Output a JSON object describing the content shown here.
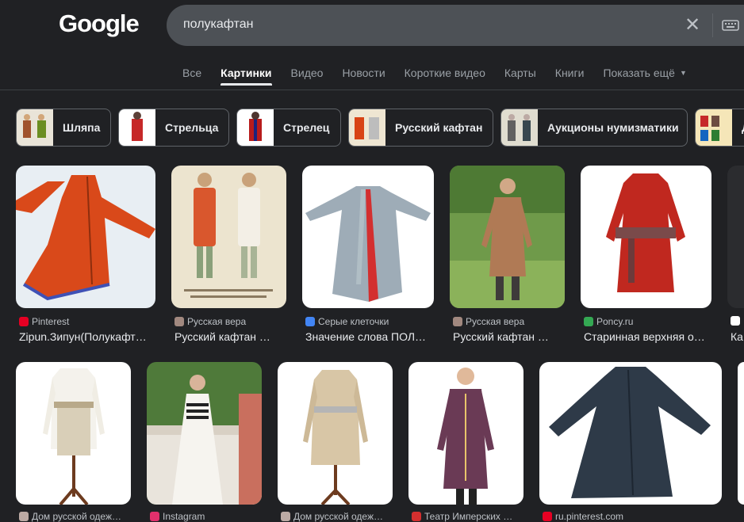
{
  "header": {
    "logo": "Google",
    "query": "полукафтан"
  },
  "tabs": [
    {
      "label": "Все",
      "active": false
    },
    {
      "label": "Картинки",
      "active": true
    },
    {
      "label": "Видео",
      "active": false
    },
    {
      "label": "Новости",
      "active": false
    },
    {
      "label": "Короткие видео",
      "active": false
    },
    {
      "label": "Карты",
      "active": false
    },
    {
      "label": "Книги",
      "active": false
    },
    {
      "label": "Показать ещё",
      "active": false
    }
  ],
  "chips": [
    {
      "label": "Шляпа"
    },
    {
      "label": "Стрельца"
    },
    {
      "label": "Стрелец"
    },
    {
      "label": "Русский кафтан"
    },
    {
      "label": "Аукционы нумизматики"
    },
    {
      "label": "Д"
    }
  ],
  "results_row1": [
    {
      "source": "Pinterest",
      "title": "Zipun.Зипун(Полукафт…",
      "fav": "#e60023"
    },
    {
      "source": "Русская вера",
      "title": "Русский кафтан …",
      "fav": "#a1887f"
    },
    {
      "source": "Серые клеточки",
      "title": "Значение слова ПОЛ…",
      "fav": "#4285f4"
    },
    {
      "source": "Русская вера",
      "title": "Русский кафтан …",
      "fav": "#a1887f"
    },
    {
      "source": "Poncy.ru",
      "title": "Старинная верхняя о…",
      "fav": "#34a853"
    },
    {
      "source": "",
      "title": "Ка",
      "fav": "#ffffff"
    }
  ],
  "results_row2": [
    {
      "source": "Дом русской одеж…",
      "fav": "#bcaaa4"
    },
    {
      "source": "Instagram",
      "fav": "#e1306c"
    },
    {
      "source": "Дом русской одеж…",
      "fav": "#bcaaa4"
    },
    {
      "source": "Театр Имперских …",
      "fav": "#d32f2f"
    },
    {
      "source": "ru.pinterest.com",
      "fav": "#e60023"
    }
  ],
  "colors": {
    "background": "#202124",
    "search_bg": "#4d5156",
    "text": "#e8eaed",
    "muted": "#9aa0a6"
  }
}
